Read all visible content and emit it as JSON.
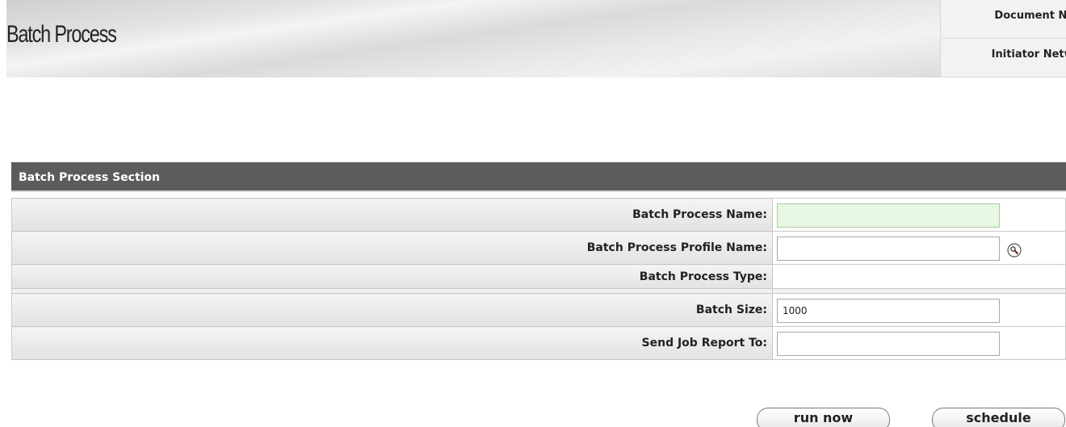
{
  "header": {
    "title": "Batch Process",
    "document_number_label": "Document Nur",
    "initiator_label": "Initiator Networ"
  },
  "section": {
    "title": "Batch Process Section"
  },
  "form": {
    "batch_process_name": {
      "label": "Batch Process Name:",
      "value": ""
    },
    "batch_process_profile_name": {
      "label": "Batch Process Profile Name:",
      "value": ""
    },
    "batch_process_type": {
      "label": "Batch Process Type:"
    },
    "batch_size": {
      "label": "Batch Size:",
      "value": "1000"
    },
    "send_job_report_to": {
      "label": "Send Job Report To:",
      "value": ""
    }
  },
  "buttons": {
    "run_now": "run now",
    "schedule": "schedule"
  }
}
